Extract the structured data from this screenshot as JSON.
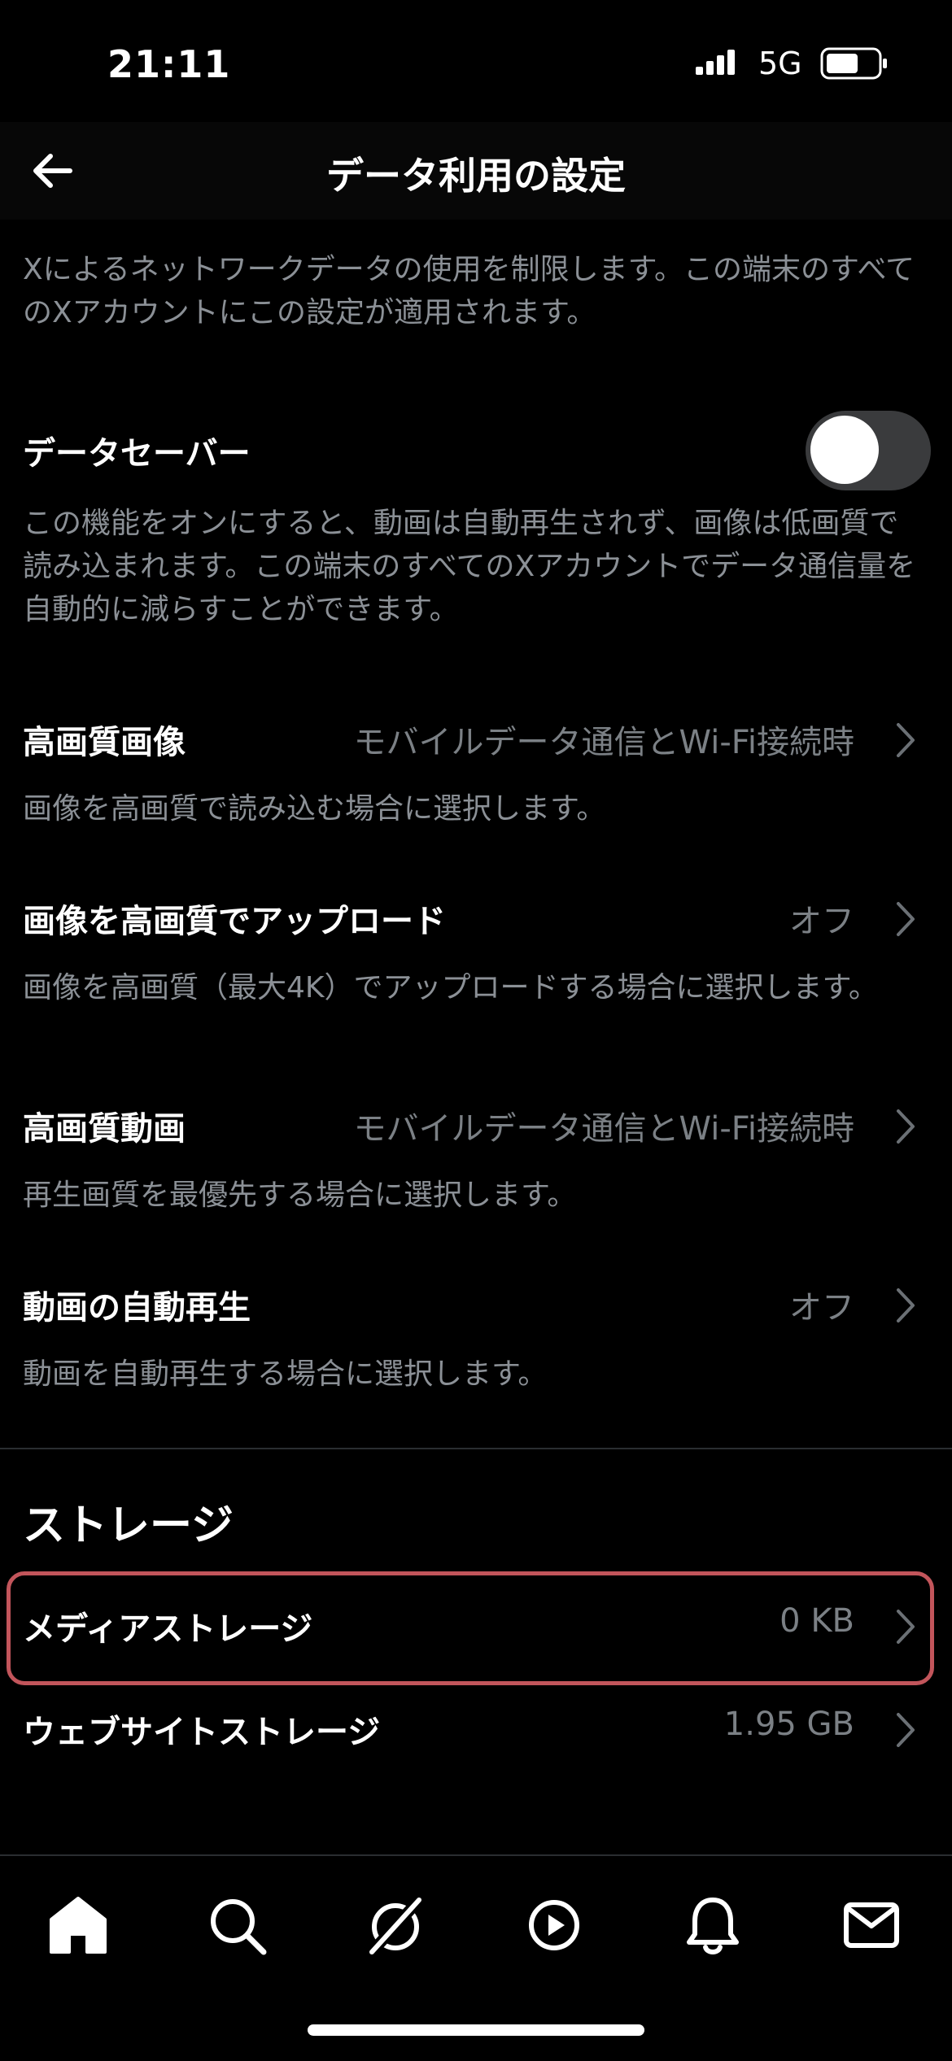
{
  "status_bar": {
    "time": "21:11",
    "network": "5G"
  },
  "header": {
    "title": "データ利用の設定"
  },
  "intro": "Xによるネットワークデータの使用を制限します。この端末のすべてのXアカウントにこの設定が適用されます。",
  "data_saver": {
    "label": "データセーバー",
    "enabled": false,
    "description": "この機能をオンにすると、動画は自動再生されず、画像は低画質で読み込まれます。この端末のすべてのXアカウントでデータ通信量を自動的に減らすことができます。"
  },
  "settings": [
    {
      "title": "高画質画像",
      "value": "モバイルデータ通信とWi-Fi接続時",
      "description": "画像を高画質で読み込む場合に選択します。"
    },
    {
      "title": "画像を高画質でアップロード",
      "value": "オフ",
      "description": "画像を高画質（最大4K）でアップロードする場合に選択します。"
    },
    {
      "title": "高画質動画",
      "value": "モバイルデータ通信とWi-Fi接続時",
      "description": "再生画質を最優先する場合に選択します。"
    },
    {
      "title": "動画の自動再生",
      "value": "オフ",
      "description": "動画を自動再生する場合に選択します。"
    }
  ],
  "storage": {
    "heading": "ストレージ",
    "items": [
      {
        "title": "メディアストレージ",
        "value": "0 KB"
      },
      {
        "title": "ウェブサイトストレージ",
        "value": "1.95 GB"
      }
    ]
  },
  "tabbar": [
    "home-icon",
    "search-icon",
    "grok-icon",
    "video-icon",
    "notifications-icon",
    "messages-icon"
  ],
  "colors": {
    "background": "#000000",
    "highlight_border": "#c2555b",
    "secondary_text": "#8b9096"
  }
}
